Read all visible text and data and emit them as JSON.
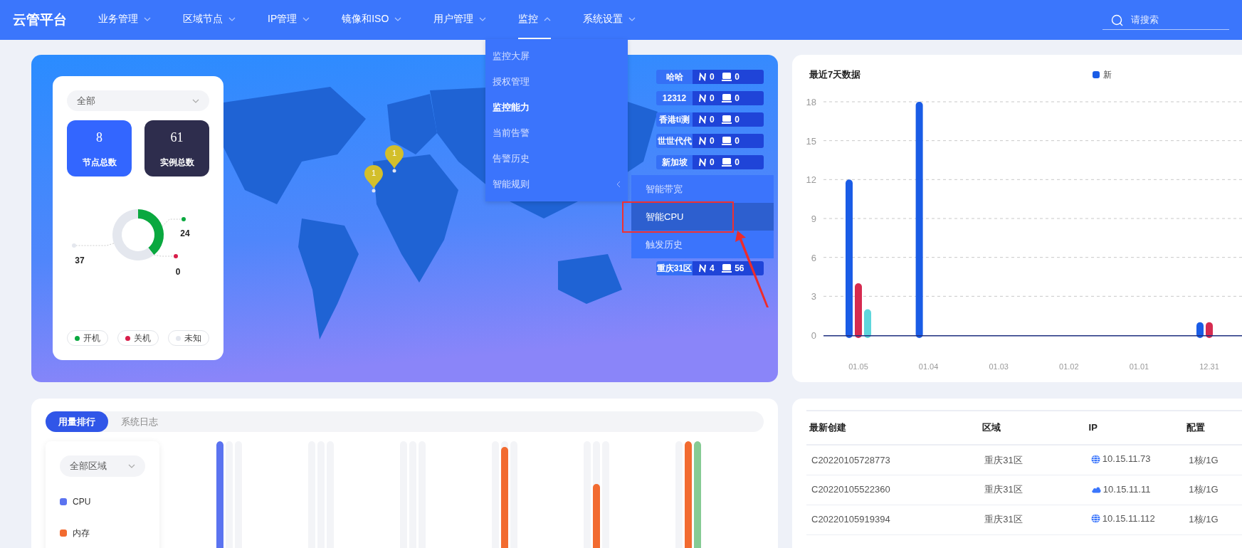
{
  "brand": "云管平台",
  "nav": [
    {
      "label": "业务管理",
      "selected": false,
      "expanded": false
    },
    {
      "label": "区域节点",
      "selected": false,
      "expanded": false
    },
    {
      "label": "IP管理",
      "selected": false,
      "expanded": false
    },
    {
      "label": "镜像和ISO",
      "selected": false,
      "expanded": false
    },
    {
      "label": "用户管理",
      "selected": false,
      "expanded": false
    },
    {
      "label": "监控",
      "selected": true,
      "expanded": true
    },
    {
      "label": "系统设置",
      "selected": false,
      "expanded": false
    }
  ],
  "search": {
    "placeholder": "请搜索"
  },
  "dropdown": [
    {
      "label": "监控大屏",
      "selected": false
    },
    {
      "label": "授权管理",
      "selected": false
    },
    {
      "label": "监控能力",
      "selected": true
    },
    {
      "label": "当前告警",
      "selected": false
    },
    {
      "label": "告警历史",
      "selected": false
    },
    {
      "label": "智能规则",
      "selected": false,
      "expanded": true,
      "children": [
        {
          "label": "智能带宽",
          "selected": false,
          "highlighted": false
        },
        {
          "label": "智能CPU",
          "selected": true,
          "highlighted": true
        },
        {
          "label": "触发历史",
          "selected": false,
          "highlighted": false
        }
      ]
    }
  ],
  "overview": {
    "filter": "全部",
    "stats": [
      {
        "kind": "nodes",
        "value": "8",
        "label": "节点总数"
      },
      {
        "kind": "instances",
        "value": "61",
        "label": "实例总数"
      }
    ],
    "chart_data": {
      "type": "donut",
      "categories": [
        "开机",
        "关机",
        "未知"
      ],
      "values": [
        24,
        0,
        37
      ],
      "colors": [
        "#0aa83f",
        "#d81e4a",
        "#e4e7ee"
      ],
      "value_labels": [
        "24",
        "0",
        "37"
      ]
    }
  },
  "map": {
    "kind": "picture",
    "pins": [
      {
        "count": "1"
      },
      {
        "count": "1"
      }
    ],
    "regions": [
      {
        "name": "哈哈",
        "nodes": "0",
        "instances": "0"
      },
      {
        "name": "12312",
        "nodes": "0",
        "instances": "0"
      },
      {
        "name": "香港ti测",
        "nodes": "0",
        "instances": "0"
      },
      {
        "name": "世世代代",
        "nodes": "0",
        "instances": "0"
      },
      {
        "name": "新加坡",
        "nodes": "0",
        "instances": "0"
      },
      {
        "name": "重庆31区",
        "nodes": "4",
        "instances": "56"
      }
    ]
  },
  "recent": {
    "title": "最近7天数据",
    "chart_data": {
      "type": "bar",
      "categories": [
        "01.05",
        "01.04",
        "01.03",
        "01.02",
        "01.01",
        "12.31"
      ],
      "series": [
        {
          "name": "新",
          "color": "#1a5ce6",
          "values": [
            12,
            18,
            0,
            0,
            0,
            1
          ]
        },
        {
          "color": "#d62b50",
          "values": [
            4,
            0,
            0,
            0,
            0,
            1
          ]
        },
        {
          "color": "#5fd6dc",
          "values": [
            2,
            0,
            0,
            0,
            0,
            0
          ]
        }
      ],
      "ylim": [
        0,
        18
      ],
      "yticks": [
        0,
        3,
        6,
        9,
        12,
        15,
        18
      ],
      "grid": true
    }
  },
  "usage": {
    "tabs": [
      {
        "label": "用量排行",
        "selected": true
      },
      {
        "label": "系统日志",
        "selected": false
      }
    ],
    "filter": "全部区域",
    "legend": [
      {
        "label": "CPU",
        "color": "#5b73f0"
      },
      {
        "label": "内存",
        "color": "#f26b30"
      }
    ],
    "groups": [
      {
        "bars": [
          {
            "level": 1
          },
          {
            "level": 0
          },
          {
            "level": 0
          }
        ]
      },
      {
        "bars": [
          {
            "level": 0
          },
          {
            "level": 0
          },
          {
            "level": 0
          }
        ]
      },
      {
        "bars": [
          {
            "level": 0
          },
          {
            "level": 0
          },
          {
            "level": 0
          }
        ]
      },
      {
        "bars": [
          {
            "level": 0
          },
          {
            "level": 0.96
          },
          {
            "level": 0
          }
        ]
      },
      {
        "bars": [
          {
            "level": 0
          },
          {
            "level": 0.7
          },
          {
            "level": 0
          }
        ]
      },
      {
        "bars": [
          {
            "level": 0
          },
          {
            "level": 1
          },
          {
            "level": 1
          }
        ]
      }
    ]
  },
  "table": {
    "columns": [
      "最新创建",
      "区域",
      "IP",
      "配置"
    ],
    "rows": [
      {
        "name": "C20220105728773",
        "region": "重庆31区",
        "kind": "globe",
        "ip": "10.15.11.73",
        "spec": "1核/1G"
      },
      {
        "name": "C20220105522360",
        "region": "重庆31区",
        "kind": "cloud",
        "ip": "10.15.11.11",
        "spec": "1核/1G"
      },
      {
        "name": "C20220105919394",
        "region": "重庆31区",
        "kind": "globe",
        "ip": "10.15.11.112",
        "spec": "1核/1G"
      }
    ]
  }
}
